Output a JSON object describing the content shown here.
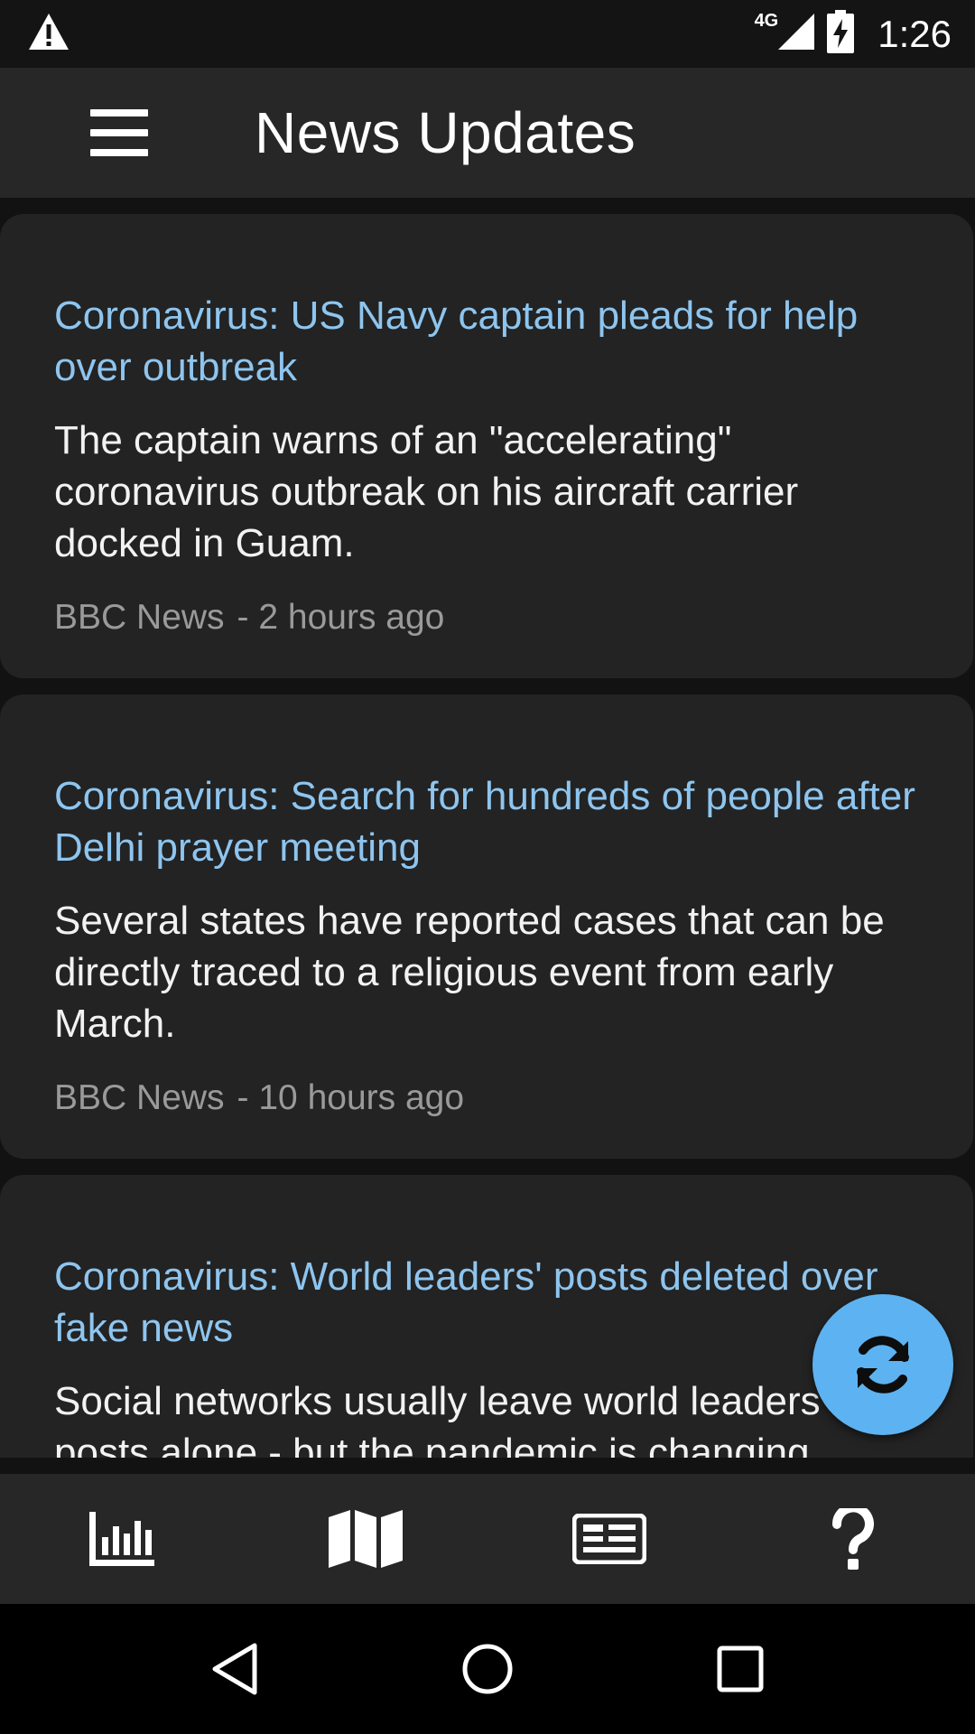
{
  "status_bar": {
    "time": "1:26",
    "network_label": "4G",
    "icons": [
      "warning-icon",
      "signal-icon",
      "battery-charging-icon"
    ]
  },
  "app_bar": {
    "title": "News Updates",
    "menu_icon": "hamburger-menu-icon"
  },
  "articles": [
    {
      "title": "Coronavirus: US Navy captain pleads for help over outbreak",
      "description": "The captain warns of an \"accelerating\" coronavirus outbreak on his aircraft carrier docked in Guam.",
      "source": "BBC News",
      "time": "- 2 hours ago"
    },
    {
      "title": "Coronavirus: Search for hundreds of people after Delhi prayer meeting",
      "description": "Several states have reported cases that can be directly traced to a religious event from early March.",
      "source": "BBC News",
      "time": "- 10 hours ago"
    },
    {
      "title": "Coronavirus: World leaders' posts deleted over fake news",
      "description": "Social networks usually leave world leaders' posts alone - but the pandemic is changing",
      "source": "",
      "time": ""
    }
  ],
  "fab": {
    "icon": "refresh-icon",
    "color": "#5db3f1"
  },
  "bottom_nav": {
    "items": [
      {
        "icon": "stats-chart-icon"
      },
      {
        "icon": "map-icon"
      },
      {
        "icon": "newspaper-icon"
      },
      {
        "icon": "help-icon"
      }
    ]
  },
  "system_nav": {
    "icons": [
      "back-icon",
      "home-icon",
      "recents-icon"
    ]
  },
  "colors": {
    "background": "#121212",
    "card": "#232323",
    "bar": "#272727",
    "title_link": "#8ec5ef",
    "meta_text": "#9a9a9a",
    "accent": "#5db3f1"
  }
}
